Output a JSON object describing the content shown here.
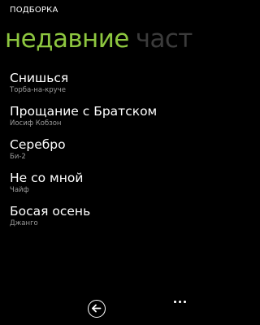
{
  "app": {
    "title": "ПОДБОРКА"
  },
  "pivot": {
    "active": "недавние",
    "next": "част"
  },
  "songs": [
    {
      "title": "Снишься",
      "artist": "Торба-на-круче"
    },
    {
      "title": "Прощание с Братском",
      "artist": "Иосиф Кобзон"
    },
    {
      "title": "Серебро",
      "artist": "Би-2"
    },
    {
      "title": "Не со мной",
      "artist": "Чайф"
    },
    {
      "title": "Босая осень",
      "artist": "Джанго"
    }
  ],
  "app_bar": {
    "back_icon": "back-arrow-icon",
    "more_icon": "ellipsis-icon"
  },
  "colors": {
    "accent": "#8dc63f",
    "background": "#000000",
    "secondary_text": "#9a9a9a",
    "inactive_pivot": "#3b3b3b"
  }
}
